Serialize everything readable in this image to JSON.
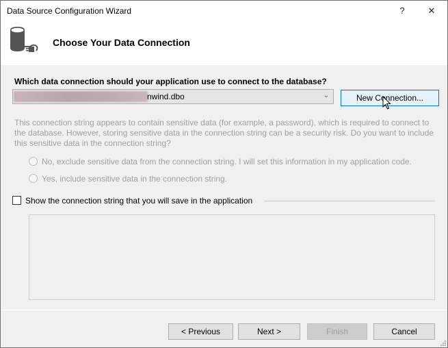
{
  "window": {
    "title": "Data Source Configuration Wizard",
    "help_label": "?",
    "close_label": "✕"
  },
  "header": {
    "icon": "database-plug-icon",
    "title": "Choose Your Data Connection"
  },
  "connection": {
    "question": "Which data connection should your application use to connect to the database?",
    "selected_value": "nwind.dbo",
    "new_connection_label": "New Connection..."
  },
  "sensitive": {
    "message": "This connection string appears to contain sensitive data (for example, a password), which is required to connect to the database. However, storing sensitive data in the connection string can be a security risk. Do you want to include this sensitive data in the connection string?",
    "options": [
      {
        "label": "No, exclude sensitive data from the connection string. I will set this information in my application code.",
        "selected": false,
        "enabled": false
      },
      {
        "label": "Yes, include sensitive data in the connection string.",
        "selected": false,
        "enabled": false
      }
    ]
  },
  "show_string": {
    "label": "Show the connection string that you will save in the application",
    "checked": false,
    "value": ""
  },
  "footer": {
    "previous_label": "< Previous",
    "next_label": "Next >",
    "finish_label": "Finish",
    "cancel_label": "Cancel"
  }
}
